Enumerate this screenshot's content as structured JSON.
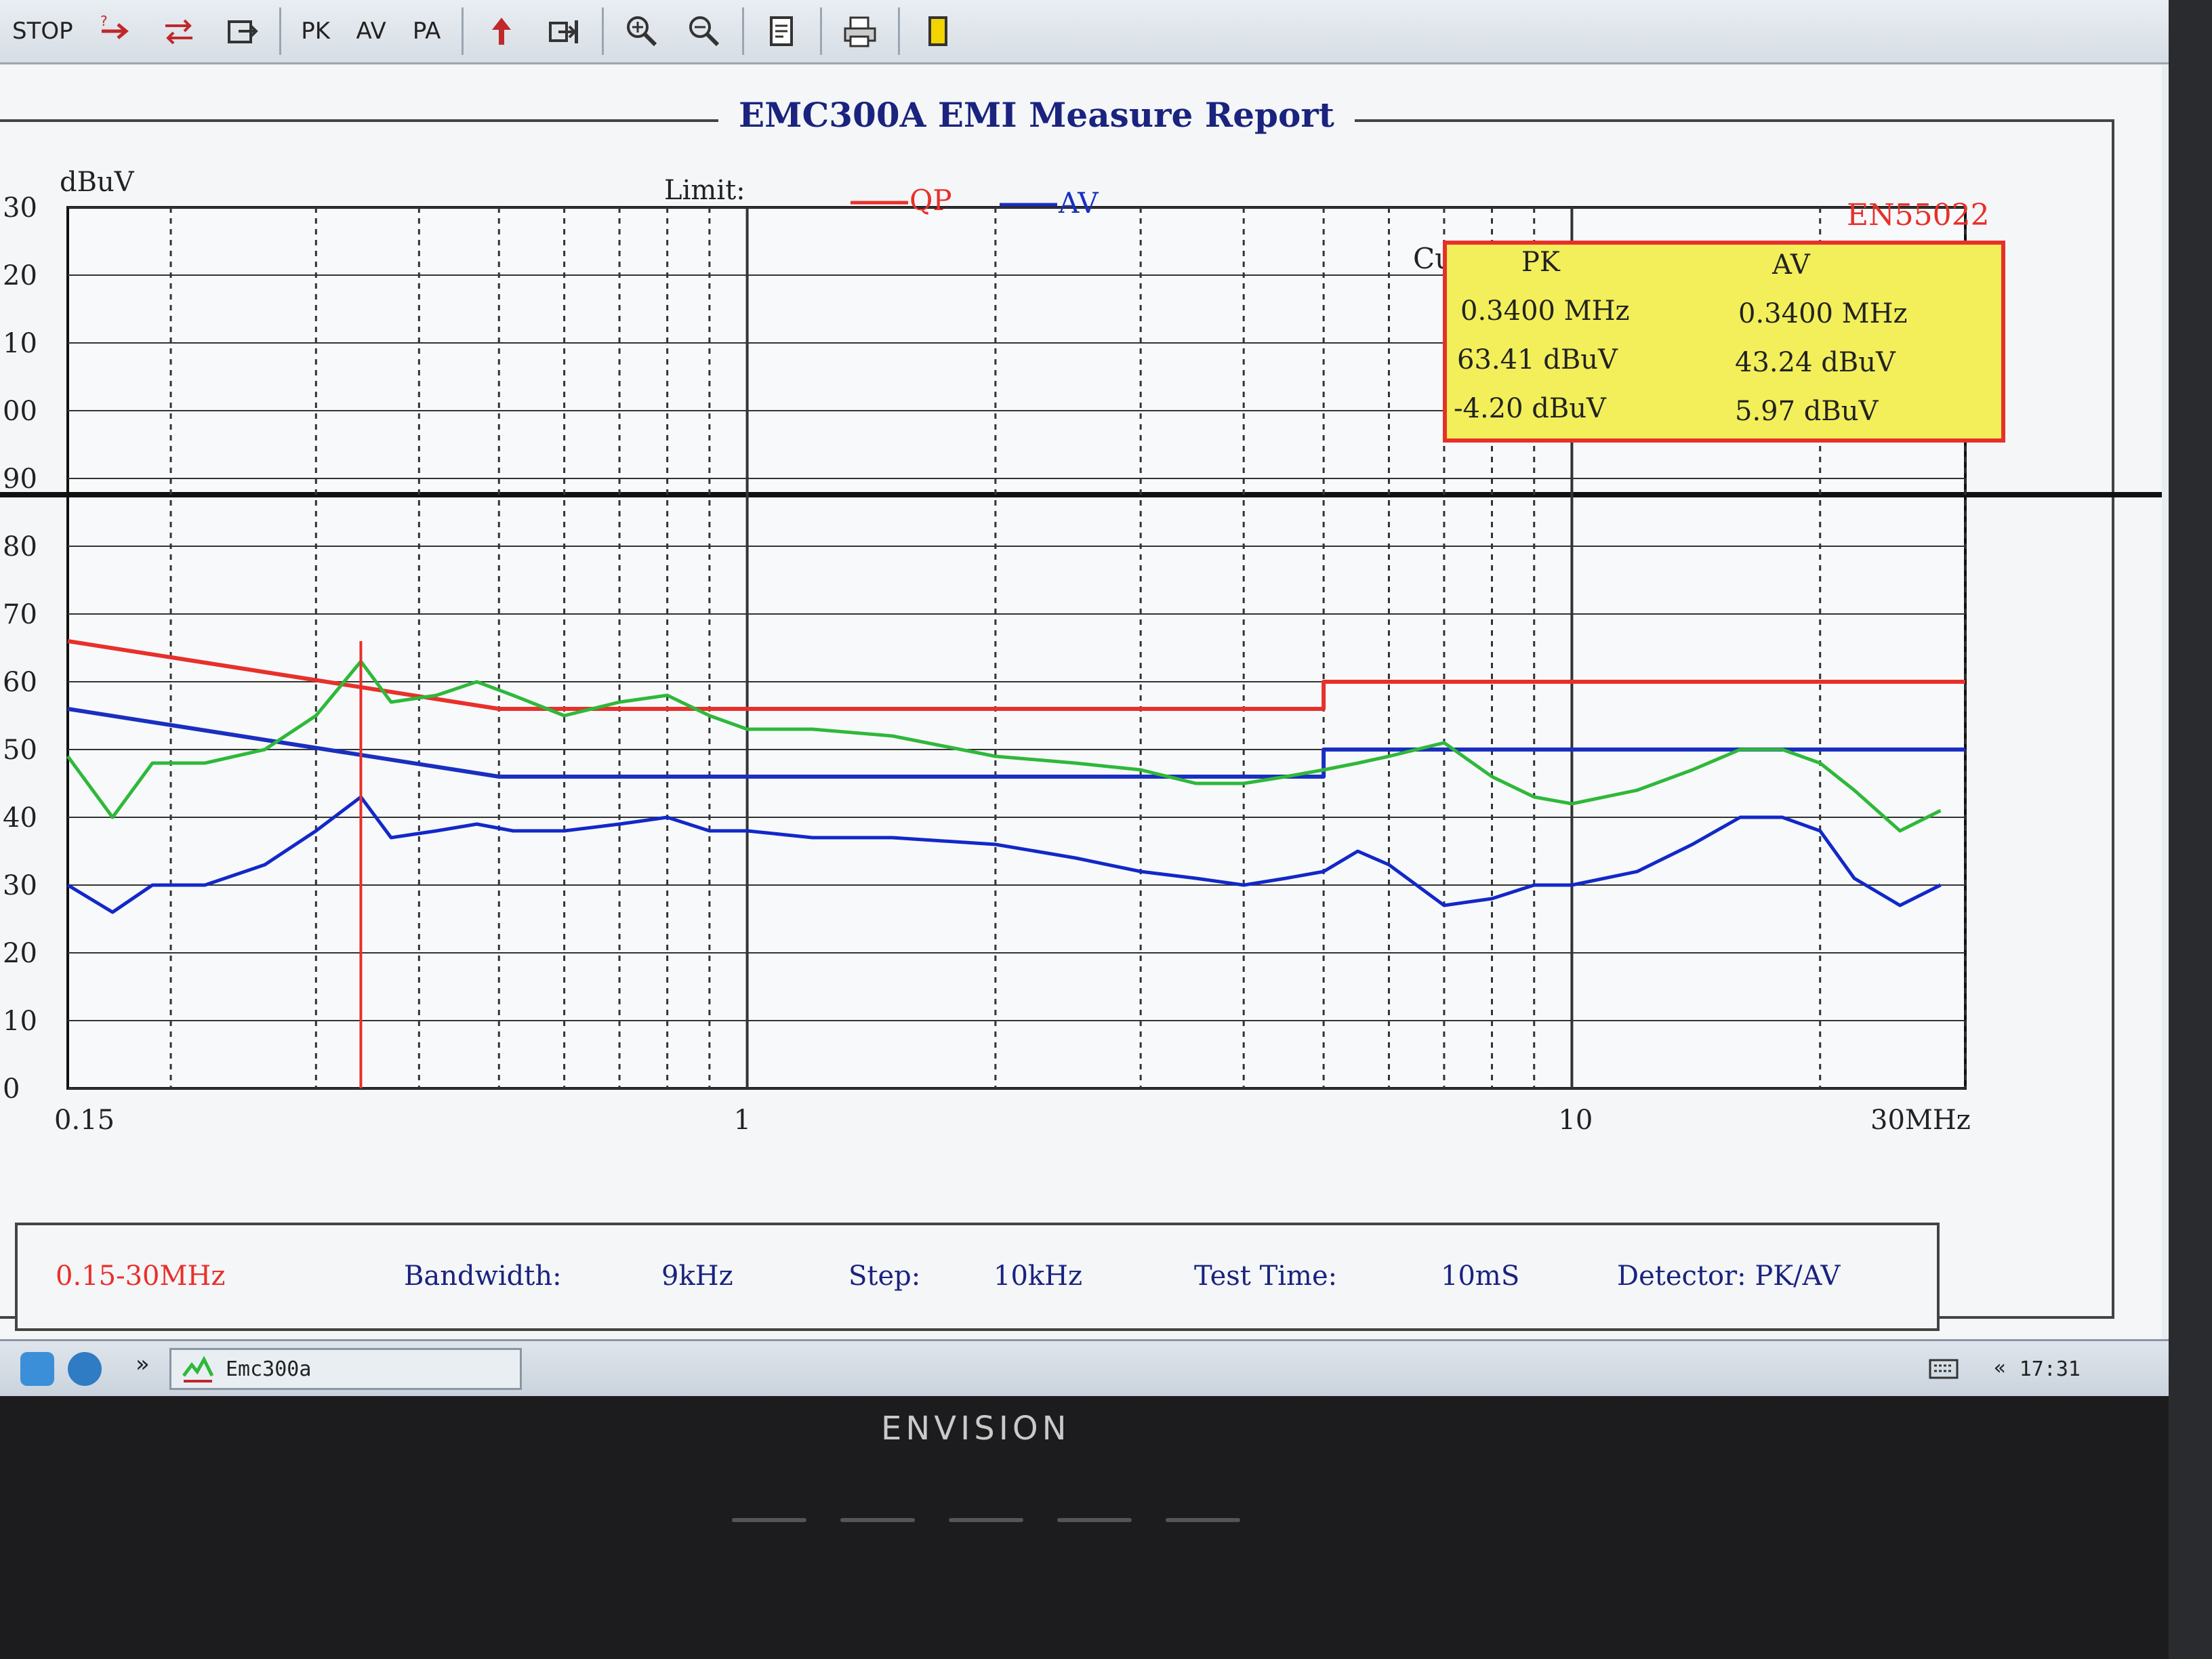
{
  "toolbar": {
    "buttons": [
      "STOP",
      "PK",
      "AV",
      "PA"
    ]
  },
  "report": {
    "title": "EMC300A EMI Measure Report",
    "standard": "EN55022",
    "limit_label": "Limit:",
    "legend_qp": "QP",
    "legend_av": "AV",
    "cursor_label": "Cu"
  },
  "marker_box": {
    "pk_header": "PK",
    "av_header": "AV",
    "pk_freq": "0.3400 MHz",
    "av_freq": "0.3400 MHz",
    "pk_level": "63.41 dBuV",
    "av_level": "43.24 dBuV",
    "pk_margin": "-4.20 dBuV",
    "av_margin": "5.97 dBuV"
  },
  "info_bar": {
    "range": "0.15-30MHz",
    "bandwidth_label": "Bandwidth:",
    "bandwidth_value": "9kHz",
    "step_label": "Step:",
    "step_value": "10kHz",
    "test_time_label": "Test Time:",
    "test_time_value": "10mS",
    "detector": "Detector: PK/AV"
  },
  "taskbar": {
    "task": "Emc300a",
    "clock": "17:31",
    "chevron": "»",
    "tray_chevron": "«"
  },
  "bezel": {
    "brand": "ENVISION"
  },
  "colors": {
    "qp": "#e8302a",
    "av": "#1a2fc0",
    "pk_trace": "#2fb83a",
    "av_trace": "#1228c8",
    "marker_fill": "#f2ef5a",
    "marker_border": "#e8302a"
  },
  "chart_data": {
    "type": "line",
    "ylabel": "dBuV",
    "xlabel": "",
    "x_scale": "log",
    "xlim": [
      0.15,
      30
    ],
    "ylim": [
      0,
      130
    ],
    "x_tick_labels": [
      "0.15",
      "1",
      "10",
      "30MHz"
    ],
    "x_ticks": [
      0.15,
      1,
      10,
      30
    ],
    "y_ticks": [
      0,
      10,
      20,
      30,
      40,
      50,
      60,
      70,
      80,
      90,
      100,
      110,
      120,
      130
    ],
    "y_tick_labels": [
      "0",
      "10",
      "20",
      "30",
      "40",
      "50",
      "60",
      "70",
      "80",
      "90",
      "00",
      "10",
      "20",
      "30"
    ],
    "series": [
      {
        "name": "QP",
        "x": [
          0.15,
          0.5,
          0.5,
          5,
          5,
          30
        ],
        "y": [
          66,
          56,
          56,
          56,
          60,
          60
        ]
      },
      {
        "name": "AV",
        "x": [
          0.15,
          0.5,
          0.5,
          5,
          5,
          30
        ],
        "y": [
          56,
          46,
          46,
          46,
          50,
          50
        ]
      },
      {
        "x": [
          0.15,
          0.17,
          0.19,
          0.22,
          0.26,
          0.3,
          0.34,
          0.37,
          0.42,
          0.47,
          0.52,
          0.6,
          0.7,
          0.8,
          0.9,
          1.0,
          1.2,
          1.5,
          2.0,
          2.5,
          3.0,
          3.5,
          4.0,
          4.5,
          5.0,
          5.5,
          6.0,
          7.0,
          8.0,
          9.0,
          10.0,
          12.0,
          14.0,
          16.0,
          18.0,
          20.0,
          22.0,
          25.0,
          28.0
        ],
        "y": [
          49,
          40,
          48,
          48,
          50,
          55,
          63,
          57,
          58,
          60,
          58,
          55,
          57,
          58,
          55,
          53,
          53,
          52,
          49,
          48,
          47,
          45,
          45,
          46,
          47,
          48,
          49,
          51,
          46,
          43,
          42,
          44,
          47,
          50,
          50,
          48,
          44,
          38,
          41
        ]
      },
      {
        "x": [
          0.15,
          0.17,
          0.19,
          0.22,
          0.26,
          0.3,
          0.34,
          0.37,
          0.42,
          0.47,
          0.52,
          0.6,
          0.7,
          0.8,
          0.9,
          1.0,
          1.2,
          1.5,
          2.0,
          2.5,
          3.0,
          3.5,
          4.0,
          4.5,
          5.0,
          5.5,
          6.0,
          7.0,
          8.0,
          9.0,
          10.0,
          12.0,
          14.0,
          16.0,
          18.0,
          20.0,
          22.0,
          25.0,
          28.0
        ],
        "y": [
          30,
          26,
          30,
          30,
          33,
          38,
          43,
          37,
          38,
          39,
          38,
          38,
          39,
          40,
          38,
          38,
          37,
          37,
          36,
          34,
          32,
          31,
          30,
          31,
          32,
          35,
          33,
          27,
          28,
          30,
          30,
          32,
          36,
          40,
          40,
          38,
          31,
          27,
          30
        ]
      }
    ],
    "marker": {
      "x": 0.34
    },
    "grid": true
  }
}
